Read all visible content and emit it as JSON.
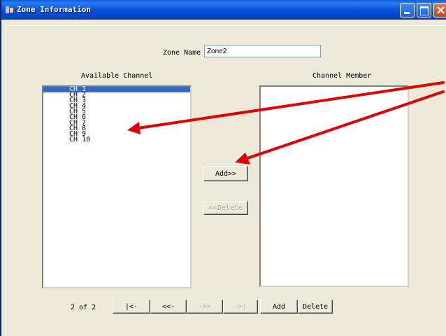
{
  "window": {
    "title": "Zone Information"
  },
  "zone": {
    "name_label": "Zone Name",
    "name_value": "Zone2"
  },
  "available": {
    "heading": "Available Channel",
    "items": [
      "CH 1",
      "CH 2",
      "CH 3",
      "CH 4",
      "CH 5",
      "CH 6",
      "CH 7",
      "CH 8",
      "CH 9",
      "CH 10"
    ],
    "selected_index": 0
  },
  "member": {
    "heading": "Channel Member",
    "items": []
  },
  "buttons": {
    "add": "Add>>",
    "delete": "<<Delete"
  },
  "nav": {
    "record": "2 of 2",
    "first": "|<-",
    "prev": "<<-",
    "next": "->>",
    "last": "->|",
    "add": "Add",
    "delete": "Delete"
  },
  "colors": {
    "annotation_arrow": "#e00000",
    "selection": "#316ac5"
  }
}
